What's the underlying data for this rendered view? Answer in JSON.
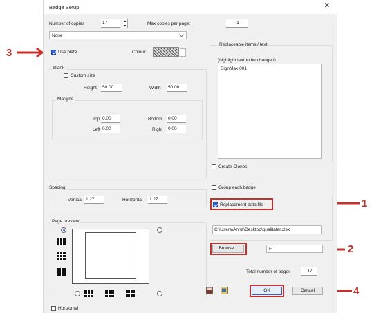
{
  "window": {
    "title": "Badge Setup",
    "close_glyph": "✕"
  },
  "copies": {
    "label": "Number of copies",
    "value": "17",
    "max_label": "Max copies per page:",
    "max_value": "1"
  },
  "plate_select": {
    "value": "None"
  },
  "use_plate": {
    "label": "Use plate",
    "checked": true,
    "colour_label": "Colour:"
  },
  "blank": {
    "group_label": "Blank",
    "custom_size_label": "Custom size",
    "height_label": "Height",
    "height_value": "50.00",
    "width_label": "Width",
    "width_value": "50.00"
  },
  "margins": {
    "group_label": "Margins",
    "top_label": "Top",
    "top_value": "0.00",
    "bottom_label": "Bottom",
    "bottom_value": "0.00",
    "left_label": "Left",
    "left_value": "0.00",
    "right_label": "Right",
    "right_value": "0.00"
  },
  "replaceable": {
    "group_label": "Replaceable items / text",
    "hint": "(highlight text to be changed)",
    "item": "SignMax 001"
  },
  "create_clones_label": "Create Clones",
  "spacing": {
    "group_label": "Spacing",
    "vertical_label": "Vertical",
    "vertical_value": "1.27",
    "horizontal_label": "Horizontal",
    "horizontal_value": "1.27"
  },
  "group_each_badge_label": "Group each badge",
  "replacement_data_file_label": "Replacement data file",
  "file_path": "C:\\Users\\Anna\\Desktop\\qualitater.xlsx",
  "browse_label": "Browse...",
  "browse_aux": "F",
  "page_preview_label": "Page preview",
  "horizontal_check_label": "Horizontal",
  "total_pages": {
    "label": "Total number of pages",
    "value": "17"
  },
  "ok_label": "OK",
  "cancel_label": "Cancel",
  "annotations": {
    "n1": "1",
    "n2": "2",
    "n3": "3",
    "n4": "4",
    "color": "#c4302b"
  }
}
